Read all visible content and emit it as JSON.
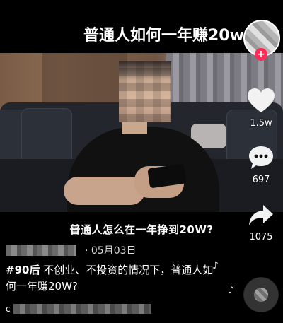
{
  "video": {
    "title": "普通人如何一年赚20w",
    "caption": "普通人怎么在一年挣到20W?"
  },
  "post": {
    "date": "· 05月03日",
    "hashtag": "#90后",
    "description": " 不创业、不投资的情况下，普通人如何一年赚20W?",
    "music_prefix": "c"
  },
  "actions": {
    "likes": "1.5w",
    "comments": "697",
    "shares": "1075",
    "follow_symbol": "+"
  },
  "icons": {
    "like": "heart-icon",
    "comment": "comment-icon",
    "share": "share-icon",
    "music": "music-note-icon"
  },
  "colors": {
    "accent": "#fe2c55",
    "background": "#000000"
  }
}
